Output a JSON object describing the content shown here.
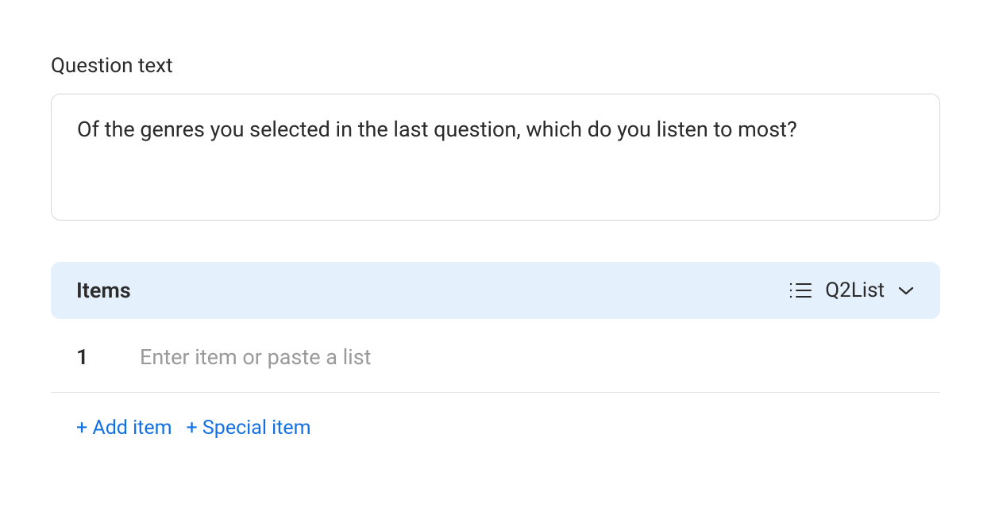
{
  "question": {
    "label": "Question text",
    "value": "Of the genres you selected in the last question, which do you listen to most?"
  },
  "items": {
    "header_label": "Items",
    "source_name": "Q2List",
    "rows": [
      {
        "index": "1",
        "value": "",
        "placeholder": "Enter item or paste a list"
      }
    ],
    "actions": {
      "add_item": "+ Add item",
      "special_item": "+ Special item"
    }
  }
}
